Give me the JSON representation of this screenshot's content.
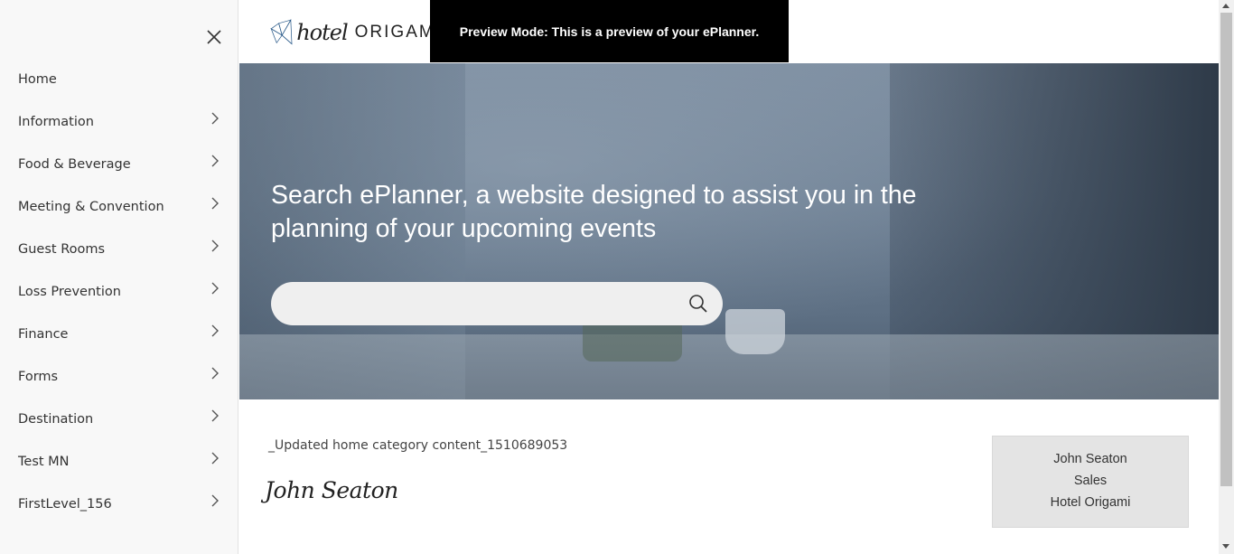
{
  "sidebar": {
    "close_icon": "close-icon",
    "items": [
      {
        "label": "Home",
        "has_submenu": false
      },
      {
        "label": "Information",
        "has_submenu": true
      },
      {
        "label": "Food & Beverage",
        "has_submenu": true
      },
      {
        "label": "Meeting & Convention",
        "has_submenu": true
      },
      {
        "label": "Guest Rooms",
        "has_submenu": true
      },
      {
        "label": "Loss Prevention",
        "has_submenu": true
      },
      {
        "label": "Finance",
        "has_submenu": true
      },
      {
        "label": "Forms",
        "has_submenu": true
      },
      {
        "label": "Destination",
        "has_submenu": true
      },
      {
        "label": "Test MN",
        "has_submenu": true
      },
      {
        "label": "FirstLevel_156",
        "has_submenu": true
      }
    ]
  },
  "header": {
    "logo_text_a": "hotel",
    "logo_text_b": "ORIGAMI",
    "preview_banner": "Preview Mode: This is a preview of your ePlanner."
  },
  "hero": {
    "title": "Search ePlanner, a website designed to assist you in the planning of your upcoming events",
    "search": {
      "value": "",
      "placeholder": "",
      "icon": "search-icon"
    }
  },
  "content": {
    "text": "_Updated home category content_1510689053",
    "signature": "John Seaton"
  },
  "contact": {
    "name": "John Seaton",
    "role": "Sales",
    "company": "Hotel Origami"
  },
  "colors": {
    "sidebar_bg": "#f8f8f8",
    "banner_bg": "#000000",
    "contact_bg": "#e4e4e4",
    "search_bg": "#efefef"
  }
}
